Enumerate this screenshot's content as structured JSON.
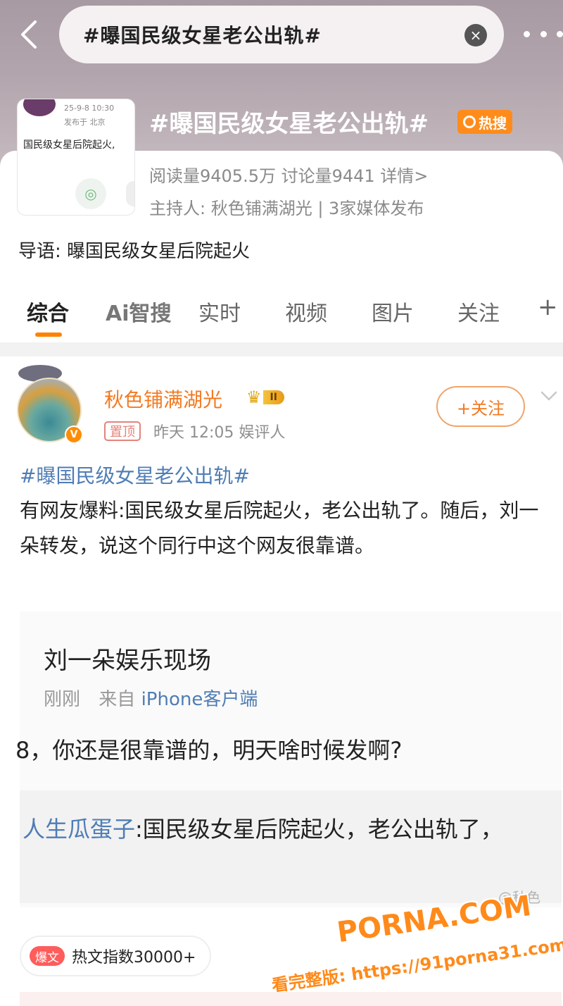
{
  "search": {
    "query": "#曝国民级女星老公出轨#"
  },
  "topic": {
    "thumb_time": "25-9-8 10:30",
    "thumb_loc": "发布于 北京",
    "thumb_text": "国民级女星后院起火,",
    "title": "#曝国民级女星老公出轨#",
    "hot_badge": "热搜",
    "stats": "阅读量9405.5万  讨论量9441  详情>",
    "host": "主持人: 秋色铺满湖光 | 3家媒体发布",
    "guide": "导语: 曝国民级女星后院起火"
  },
  "tabs": [
    {
      "label": "综合"
    },
    {
      "label": "Ai智搜"
    },
    {
      "label": "实时"
    },
    {
      "label": "视频"
    },
    {
      "label": "图片"
    },
    {
      "label": "关注"
    },
    {
      "label": "+"
    }
  ],
  "post": {
    "author": "秋色铺满湖光",
    "level": "II",
    "verify": "V",
    "pin_tag": "置顶",
    "meta": "昨天 12:05  娱评人",
    "follow_label": "+关注",
    "hashtag": "#曝国民级女星老公出轨#",
    "body": "有网友爆料:国民级女星后院起火，老公出轨了。随后，刘一朵转发，说这个同行中这个网友很靠谱。"
  },
  "embedded_screenshot": {
    "name": "刘一朵娱乐现场",
    "time": "刚刚",
    "from_label": "来自",
    "source": "iPhone客户端",
    "reply": "8，你还是很靠谱的，明天啥时候发啊?",
    "quote_name": "人生瓜蛋子",
    "quote_text": ":国民级女星后院起火，老公出轨了，",
    "watermark": "@秋色"
  },
  "hotpost": {
    "pill": "爆文",
    "index": "热文指数30000+"
  },
  "watermarks": {
    "brand": "PORNA.COM",
    "url": "看完整版: https://91porna31.com"
  },
  "colors": {
    "accent": "#ff8200",
    "link": "#4f7db5",
    "author": "#f27a22"
  }
}
